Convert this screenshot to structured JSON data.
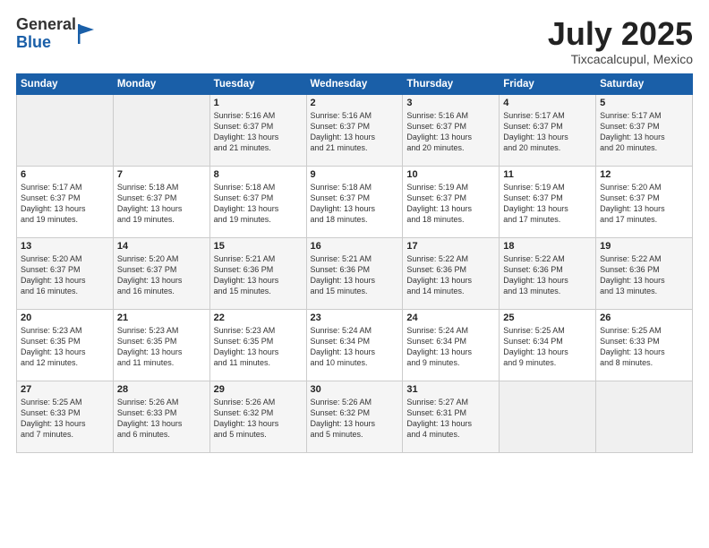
{
  "header": {
    "logo_general": "General",
    "logo_blue": "Blue",
    "month_title": "July 2025",
    "location": "Tixcacalcupul, Mexico"
  },
  "weekdays": [
    "Sunday",
    "Monday",
    "Tuesday",
    "Wednesday",
    "Thursday",
    "Friday",
    "Saturday"
  ],
  "weeks": [
    [
      {
        "day": "",
        "info": ""
      },
      {
        "day": "",
        "info": ""
      },
      {
        "day": "1",
        "info": "Sunrise: 5:16 AM\nSunset: 6:37 PM\nDaylight: 13 hours\nand 21 minutes."
      },
      {
        "day": "2",
        "info": "Sunrise: 5:16 AM\nSunset: 6:37 PM\nDaylight: 13 hours\nand 21 minutes."
      },
      {
        "day": "3",
        "info": "Sunrise: 5:16 AM\nSunset: 6:37 PM\nDaylight: 13 hours\nand 20 minutes."
      },
      {
        "day": "4",
        "info": "Sunrise: 5:17 AM\nSunset: 6:37 PM\nDaylight: 13 hours\nand 20 minutes."
      },
      {
        "day": "5",
        "info": "Sunrise: 5:17 AM\nSunset: 6:37 PM\nDaylight: 13 hours\nand 20 minutes."
      }
    ],
    [
      {
        "day": "6",
        "info": "Sunrise: 5:17 AM\nSunset: 6:37 PM\nDaylight: 13 hours\nand 19 minutes."
      },
      {
        "day": "7",
        "info": "Sunrise: 5:18 AM\nSunset: 6:37 PM\nDaylight: 13 hours\nand 19 minutes."
      },
      {
        "day": "8",
        "info": "Sunrise: 5:18 AM\nSunset: 6:37 PM\nDaylight: 13 hours\nand 19 minutes."
      },
      {
        "day": "9",
        "info": "Sunrise: 5:18 AM\nSunset: 6:37 PM\nDaylight: 13 hours\nand 18 minutes."
      },
      {
        "day": "10",
        "info": "Sunrise: 5:19 AM\nSunset: 6:37 PM\nDaylight: 13 hours\nand 18 minutes."
      },
      {
        "day": "11",
        "info": "Sunrise: 5:19 AM\nSunset: 6:37 PM\nDaylight: 13 hours\nand 17 minutes."
      },
      {
        "day": "12",
        "info": "Sunrise: 5:20 AM\nSunset: 6:37 PM\nDaylight: 13 hours\nand 17 minutes."
      }
    ],
    [
      {
        "day": "13",
        "info": "Sunrise: 5:20 AM\nSunset: 6:37 PM\nDaylight: 13 hours\nand 16 minutes."
      },
      {
        "day": "14",
        "info": "Sunrise: 5:20 AM\nSunset: 6:37 PM\nDaylight: 13 hours\nand 16 minutes."
      },
      {
        "day": "15",
        "info": "Sunrise: 5:21 AM\nSunset: 6:36 PM\nDaylight: 13 hours\nand 15 minutes."
      },
      {
        "day": "16",
        "info": "Sunrise: 5:21 AM\nSunset: 6:36 PM\nDaylight: 13 hours\nand 15 minutes."
      },
      {
        "day": "17",
        "info": "Sunrise: 5:22 AM\nSunset: 6:36 PM\nDaylight: 13 hours\nand 14 minutes."
      },
      {
        "day": "18",
        "info": "Sunrise: 5:22 AM\nSunset: 6:36 PM\nDaylight: 13 hours\nand 13 minutes."
      },
      {
        "day": "19",
        "info": "Sunrise: 5:22 AM\nSunset: 6:36 PM\nDaylight: 13 hours\nand 13 minutes."
      }
    ],
    [
      {
        "day": "20",
        "info": "Sunrise: 5:23 AM\nSunset: 6:35 PM\nDaylight: 13 hours\nand 12 minutes."
      },
      {
        "day": "21",
        "info": "Sunrise: 5:23 AM\nSunset: 6:35 PM\nDaylight: 13 hours\nand 11 minutes."
      },
      {
        "day": "22",
        "info": "Sunrise: 5:23 AM\nSunset: 6:35 PM\nDaylight: 13 hours\nand 11 minutes."
      },
      {
        "day": "23",
        "info": "Sunrise: 5:24 AM\nSunset: 6:34 PM\nDaylight: 13 hours\nand 10 minutes."
      },
      {
        "day": "24",
        "info": "Sunrise: 5:24 AM\nSunset: 6:34 PM\nDaylight: 13 hours\nand 9 minutes."
      },
      {
        "day": "25",
        "info": "Sunrise: 5:25 AM\nSunset: 6:34 PM\nDaylight: 13 hours\nand 9 minutes."
      },
      {
        "day": "26",
        "info": "Sunrise: 5:25 AM\nSunset: 6:33 PM\nDaylight: 13 hours\nand 8 minutes."
      }
    ],
    [
      {
        "day": "27",
        "info": "Sunrise: 5:25 AM\nSunset: 6:33 PM\nDaylight: 13 hours\nand 7 minutes."
      },
      {
        "day": "28",
        "info": "Sunrise: 5:26 AM\nSunset: 6:33 PM\nDaylight: 13 hours\nand 6 minutes."
      },
      {
        "day": "29",
        "info": "Sunrise: 5:26 AM\nSunset: 6:32 PM\nDaylight: 13 hours\nand 5 minutes."
      },
      {
        "day": "30",
        "info": "Sunrise: 5:26 AM\nSunset: 6:32 PM\nDaylight: 13 hours\nand 5 minutes."
      },
      {
        "day": "31",
        "info": "Sunrise: 5:27 AM\nSunset: 6:31 PM\nDaylight: 13 hours\nand 4 minutes."
      },
      {
        "day": "",
        "info": ""
      },
      {
        "day": "",
        "info": ""
      }
    ]
  ]
}
